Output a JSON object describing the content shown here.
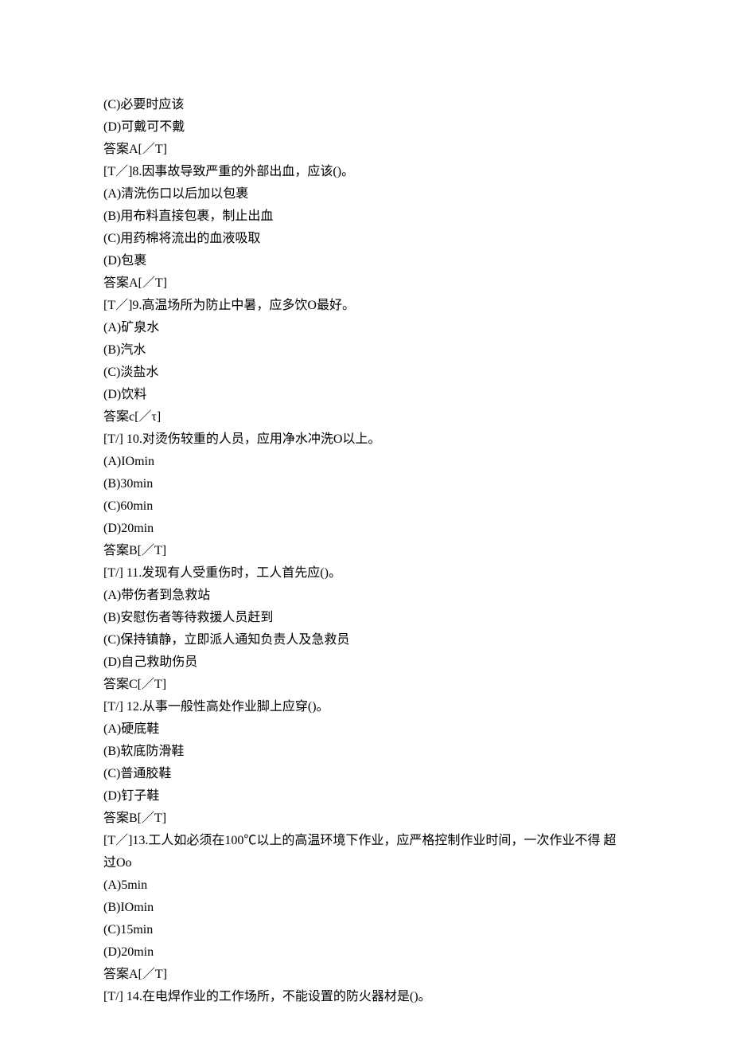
{
  "lines": [
    "(C)必要时应该",
    "(D)可戴可不戴",
    "答案A[／T]",
    "[T／]8.因事故导致严重的外部出血，应该()。",
    "(A)清洗伤口以后加以包裹",
    "(B)用布料直接包裹，制止出血",
    "(C)用药棉将流出的血液吸取",
    "(D)包裹",
    "答案A[／T]",
    "[T／]9.高温场所为防止中暑，应多饮O最好。",
    "(A)矿泉水",
    "(B)汽水",
    "(C)淡盐水",
    "(D)饮料",
    "答案c[／τ]",
    "[T/] 10.对烫伤较重的人员，应用净水冲洗O以上。",
    "(A)IOmin",
    "(B)30min",
    "(C)60min",
    "(D)20min",
    "答案B[／T]",
    "[T/] 11.发现有人受重伤时，工人首先应()。",
    "(A)带伤者到急救站",
    "(B)安慰伤者等待救援人员赶到",
    "(C)保持镇静，立即派人通知负责人及急救员",
    "(D)自己救助伤员",
    "答案C[／T]",
    "[T/] 12.从事一般性高处作业脚上应穿()。",
    "(A)硬底鞋",
    "(B)软底防滑鞋",
    "(C)普通胶鞋",
    "(D)钉子鞋",
    "答案B[／T]",
    "[T／]13.工人如必须在100℃以上的高温环境下作业，应严格控制作业时间，一次作业不得 超过Oo",
    "(A)5min",
    "(B)IOmin",
    "(C)15min",
    "(D)20min",
    "答案A[／T]",
    "[T/] 14.在电焊作业的工作场所，不能设置的防火器材是()。"
  ]
}
